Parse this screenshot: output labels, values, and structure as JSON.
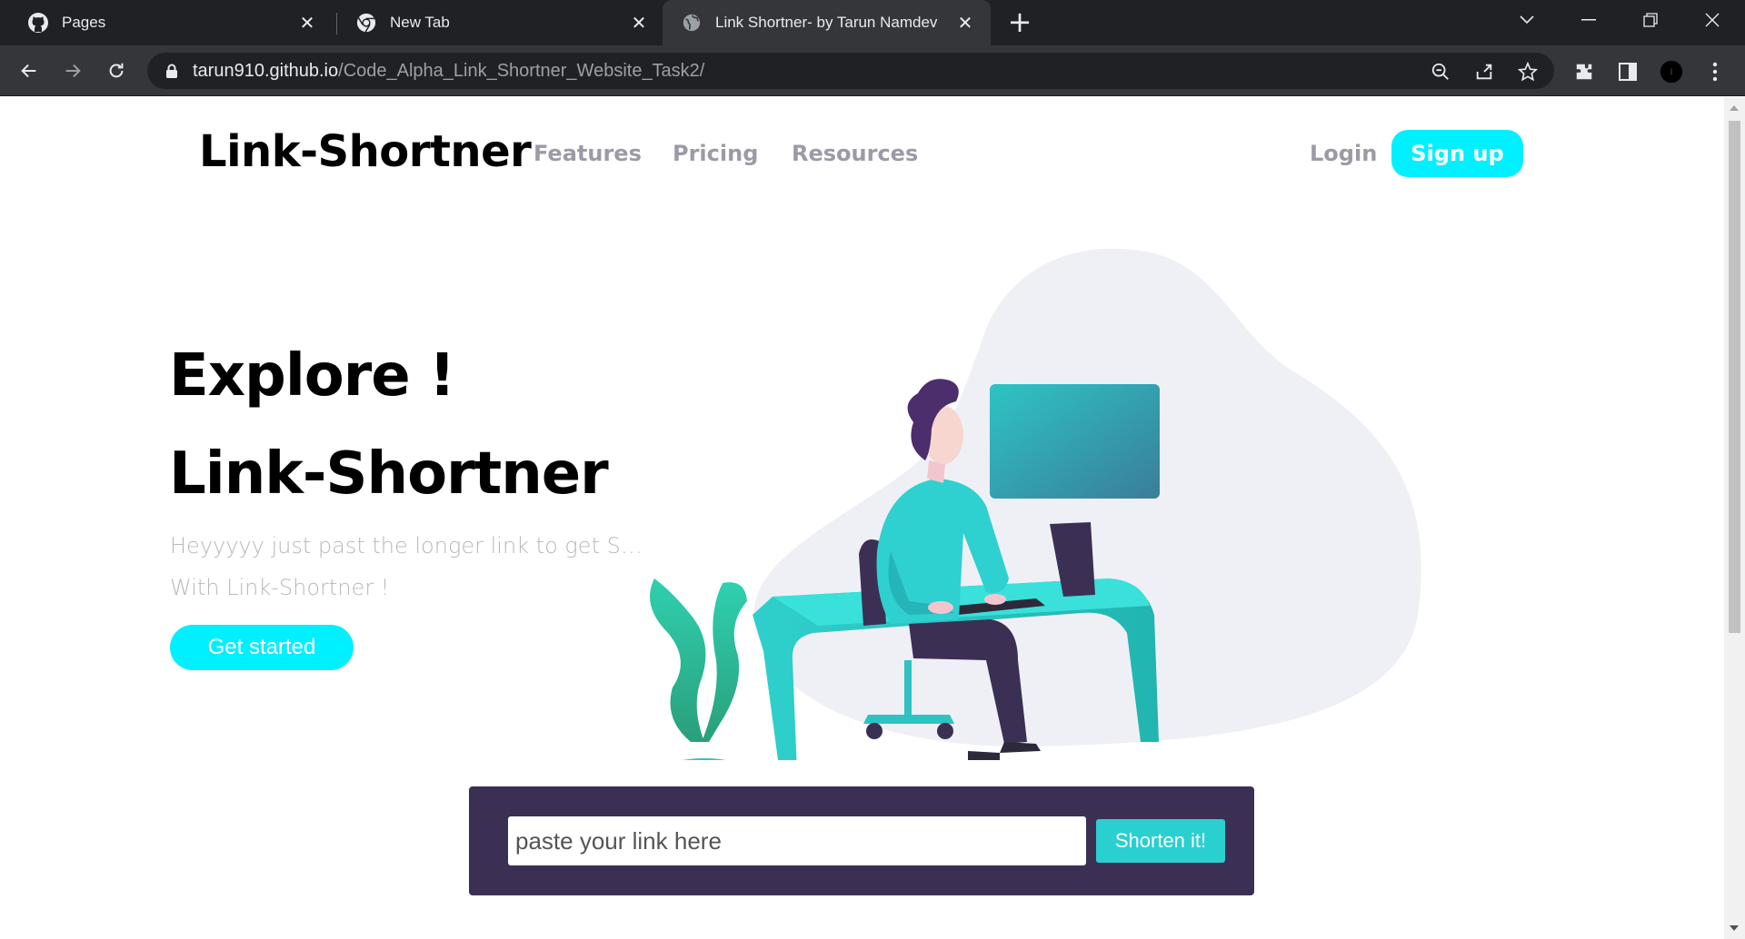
{
  "browser": {
    "tabs": [
      {
        "title": "Pages",
        "icon": "github-icon"
      },
      {
        "title": "New Tab",
        "icon": "chrome-icon"
      },
      {
        "title": "Link Shortner- by Tarun Namdev",
        "icon": "globe-icon",
        "active": true
      }
    ],
    "url_host": "tarun910.github.io",
    "url_path": "/Code_Alpha_Link_Shortner_Website_Task2/"
  },
  "header": {
    "brand": "Link-Shortner",
    "nav": [
      "Features",
      "Pricing",
      "Resources"
    ],
    "login": "Login",
    "signup": "Sign up"
  },
  "hero": {
    "title_line1": "Explore !",
    "title_line2": "Link-Shortner",
    "subtitle_line1": "Heyyyyy just past the longer link to get Short...",
    "subtitle_line2": "With Link-Shortner !",
    "cta": "Get started"
  },
  "shortener": {
    "placeholder": "paste your link here",
    "button": "Shorten it!"
  },
  "colors": {
    "accent": "#00f0ff",
    "teal": "#2acfcf",
    "dark_violet": "#3b3054",
    "nav_gray": "#9c9aa6"
  }
}
